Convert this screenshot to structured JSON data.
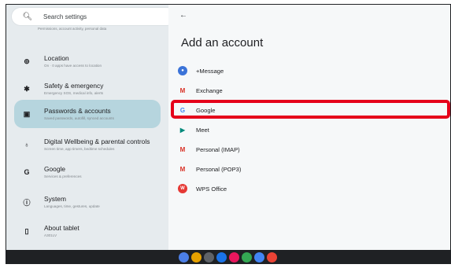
{
  "search": {
    "placeholder": "Search settings",
    "icon": "search-icon"
  },
  "sidebar": {
    "top_sub": "Permissions, account activity, personal data",
    "items": [
      {
        "title": "Location",
        "subtitle": "On · 0 apps have access to location",
        "icon": "location-icon",
        "glyph": "⊚"
      },
      {
        "title": "Safety & emergency",
        "subtitle": "Emergency SOS, medical info, alerts",
        "icon": "asterisk-icon",
        "glyph": "✱"
      },
      {
        "title": "Passwords & accounts",
        "subtitle": "Saved passwords, autofill, synced accounts",
        "icon": "accounts-icon",
        "glyph": "▣"
      },
      {
        "title": "Digital Wellbeing & parental controls",
        "subtitle": "Screen time, app timers, bedtime schedules",
        "icon": "wellbeing-icon",
        "glyph": "♁"
      },
      {
        "title": "Google",
        "subtitle": "Services & preferences",
        "icon": "google-g-icon",
        "glyph": "G"
      },
      {
        "title": "System",
        "subtitle": "Languages, time, gestures, update",
        "icon": "info-icon",
        "glyph": "ⓘ"
      },
      {
        "title": "About tablet",
        "subtitle": "A301LV",
        "icon": "tablet-icon",
        "glyph": "▯"
      }
    ]
  },
  "main": {
    "back_icon": "arrow-back-icon",
    "title": "Add an account",
    "accounts": [
      {
        "label": "+Message",
        "icon": "plus-message-icon",
        "glyph": "●",
        "color": "#3b73d8"
      },
      {
        "label": "Exchange",
        "icon": "gmail-icon",
        "glyph": "M",
        "color": "#d93025"
      },
      {
        "label": "Google",
        "icon": "google-icon",
        "glyph": "G",
        "color": "#4285f4"
      },
      {
        "label": "Meet",
        "icon": "meet-icon",
        "glyph": "▶",
        "color": "#00897b"
      },
      {
        "label": "Personal (IMAP)",
        "icon": "gmail-icon",
        "glyph": "M",
        "color": "#d93025"
      },
      {
        "label": "Personal (POP3)",
        "icon": "gmail-icon",
        "glyph": "M",
        "color": "#d93025"
      },
      {
        "label": "WPS Office",
        "icon": "wps-office-icon",
        "glyph": "W",
        "color": "#e53935"
      }
    ]
  },
  "dock": {
    "apps": [
      {
        "icon": "assistant-icon",
        "color": "#4c7fe6"
      },
      {
        "icon": "chrome-icon",
        "color": "#e6a100"
      },
      {
        "icon": "camera-icon",
        "color": "#5f6368"
      },
      {
        "icon": "settings-icon",
        "color": "#1a73e8"
      },
      {
        "icon": "app-icon",
        "color": "#e8175d"
      },
      {
        "icon": "photos-icon",
        "color": "#34a853"
      },
      {
        "icon": "files-icon",
        "color": "#4285f4"
      },
      {
        "icon": "play-store-icon",
        "color": "#ea4335"
      }
    ]
  },
  "colors": {
    "highlight": "#e5001a",
    "selected": "#b6d5de"
  }
}
